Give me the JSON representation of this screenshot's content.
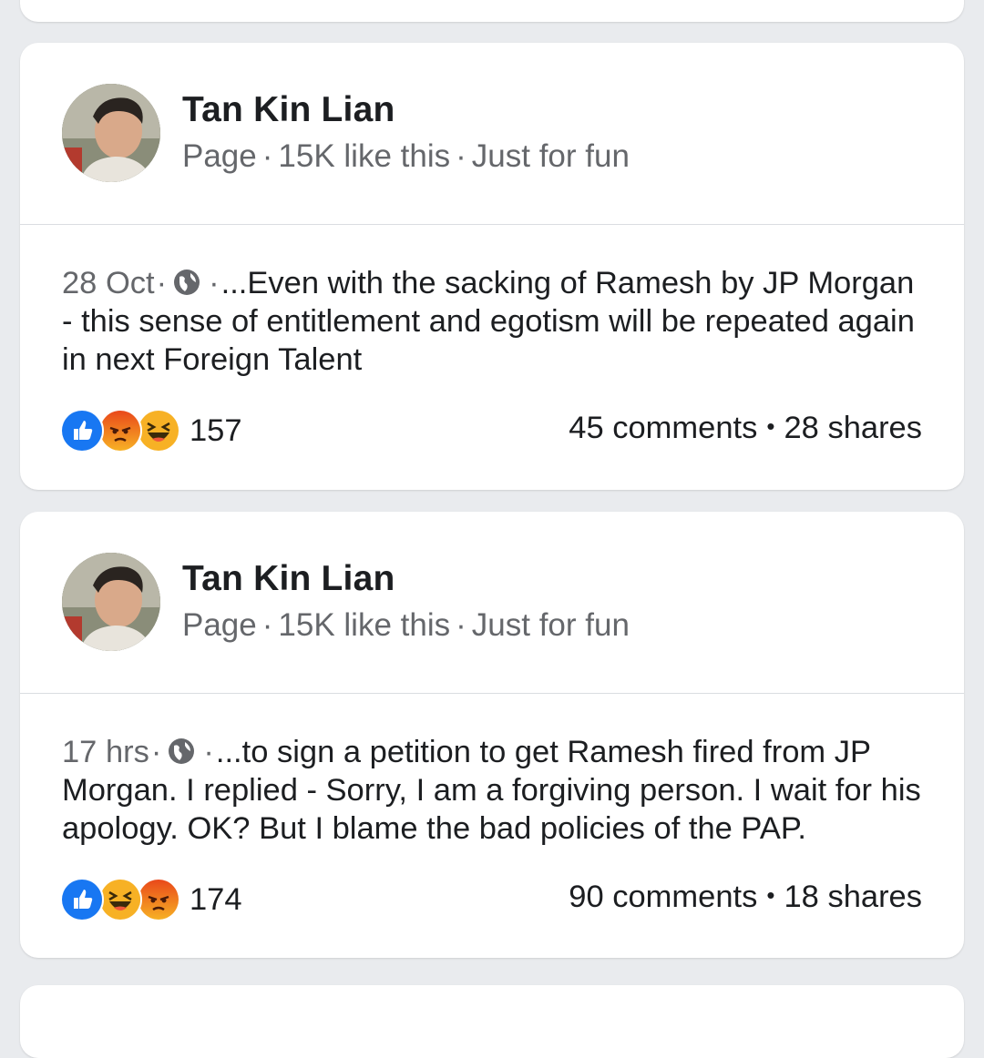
{
  "posts": [
    {
      "page_name": "Tan Kin Lian",
      "meta": {
        "type": "Page",
        "likes": "15K like this",
        "category": "Just for fun"
      },
      "time": "28 Oct",
      "text": "...Even with the sacking of Ramesh by JP Morgan - this sense of entitlement and egotism will be repeated again in next Foreign Talent",
      "reactions": [
        "like",
        "angry",
        "haha"
      ],
      "reaction_count": "157",
      "comments": "45 comments",
      "shares": "28 shares"
    },
    {
      "page_name": "Tan Kin Lian",
      "meta": {
        "type": "Page",
        "likes": "15K like this",
        "category": "Just for fun"
      },
      "time": "17 hrs",
      "text": "...to sign a petition to get Ramesh fired from JP Morgan.  I replied - Sorry, I am a forgiving person. I wait for his apology. OK? But I blame the bad policies of the PAP.",
      "reactions": [
        "like",
        "haha",
        "angry"
      ],
      "reaction_count": "174",
      "comments": "90 comments",
      "shares": "18 shares"
    }
  ],
  "icons": {
    "privacy": "globe-icon",
    "like": "like-reaction-icon",
    "angry": "angry-reaction-icon",
    "haha": "haha-reaction-icon"
  },
  "colors": {
    "background": "#e9ebee",
    "card": "#ffffff",
    "primary_text": "#1c1e21",
    "secondary_text": "#65676b",
    "like_blue": "#1877f2",
    "angry_orange": "#f2541b",
    "haha_yellow": "#f7b125"
  }
}
